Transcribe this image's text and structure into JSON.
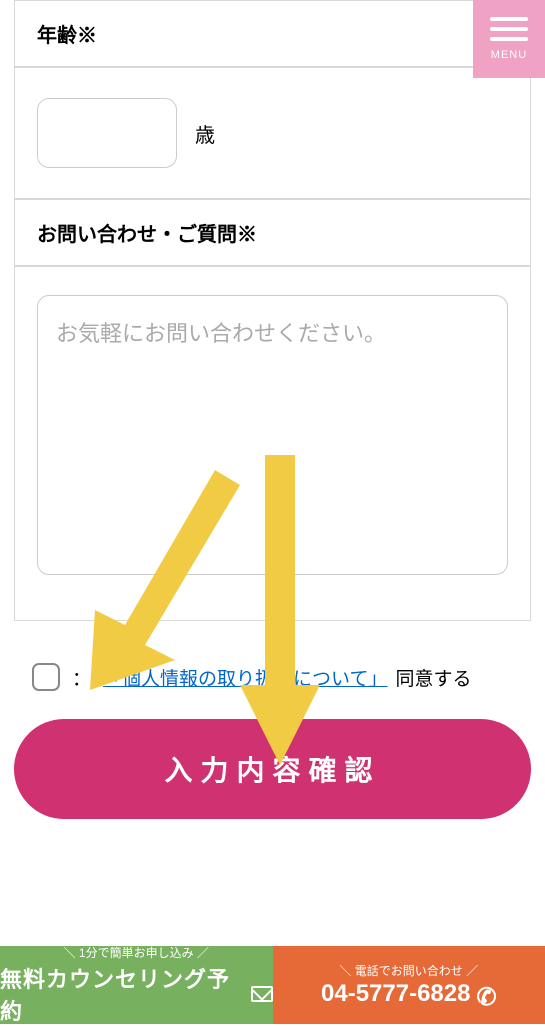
{
  "menu": {
    "label": "MENU"
  },
  "form": {
    "age": {
      "label": "年齢※",
      "value": "",
      "suffix": "歳"
    },
    "inquiry": {
      "label": "お問い合わせ・ご質問※",
      "placeholder": "お気軽にお問い合わせください。"
    },
    "consent": {
      "colon": "：",
      "link_text": "「個人情報の取り扱いについて」",
      "trail": "同意する"
    },
    "submit_label": "入力内容確認"
  },
  "footer": {
    "left": {
      "top": "＼ 1分で簡単お申し込み ／",
      "main": "無料カウンセリング予約"
    },
    "right": {
      "top": "＼ 電話でお問い合わせ ／",
      "main": "04-5777-6828"
    }
  }
}
